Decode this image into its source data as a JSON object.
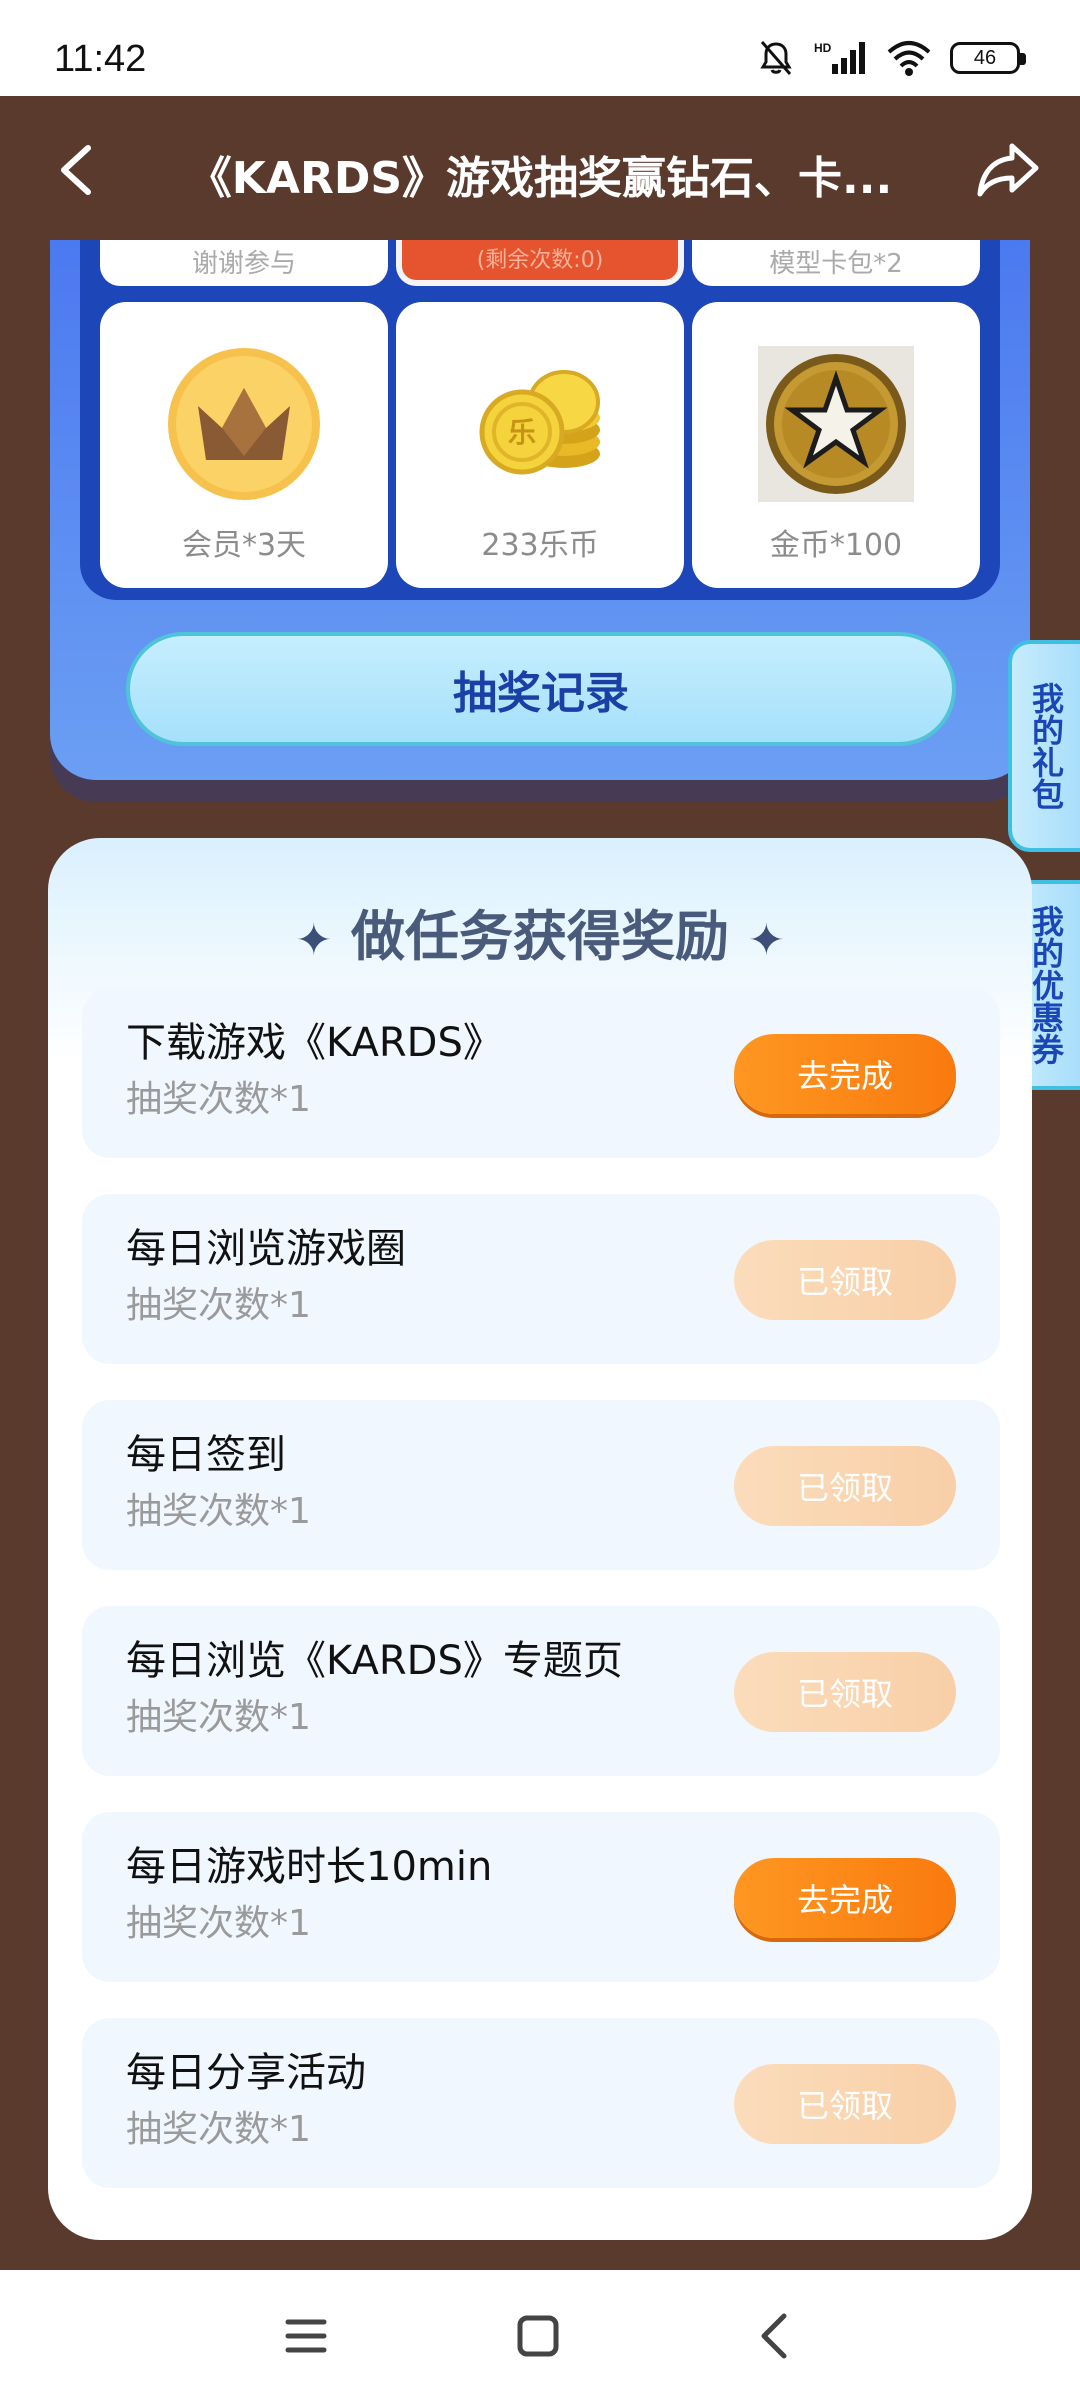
{
  "status_bar": {
    "time": "11:42",
    "battery": "46",
    "icons": [
      "bell-off-icon",
      "signal-icon",
      "wifi-icon",
      "battery-icon"
    ]
  },
  "header": {
    "title": "《KARDS》游戏抽奖赢钻石、卡...",
    "back_icon": "chevron-left-icon",
    "share_icon": "share-icon"
  },
  "prizes": {
    "partial_row": [
      {
        "label": "谢谢参与"
      },
      {
        "label": "(剩余次数:0)"
      },
      {
        "label": "模型卡包*2"
      }
    ],
    "items": [
      {
        "label": "会员*3天",
        "icon": "crown-icon"
      },
      {
        "label": "233乐币",
        "icon": "coins-icon"
      },
      {
        "label": "金币*100",
        "icon": "gold-coin-icon"
      }
    ],
    "record_button": "抽奖记录"
  },
  "side_tabs": {
    "gift": "我的礼包",
    "coupon": "我的优惠券"
  },
  "tasks": {
    "title": "做任务获得奖励",
    "items": [
      {
        "name": "下载游戏《KARDS》",
        "reward": "抽奖次数*1",
        "action": "去完成",
        "status": "pending"
      },
      {
        "name": "每日浏览游戏圈",
        "reward": "抽奖次数*1",
        "action": "已领取",
        "status": "claimed"
      },
      {
        "name": "每日签到",
        "reward": "抽奖次数*1",
        "action": "已领取",
        "status": "claimed"
      },
      {
        "name": "每日浏览《KARDS》专题页",
        "reward": "抽奖次数*1",
        "action": "已领取",
        "status": "claimed"
      },
      {
        "name": "每日游戏时长10min",
        "reward": "抽奖次数*1",
        "action": "去完成",
        "status": "pending"
      },
      {
        "name": "每日分享活动",
        "reward": "抽奖次数*1",
        "action": "已领取",
        "status": "claimed"
      }
    ]
  },
  "colors": {
    "background": "#5a3a2d",
    "accent_orange": "#f97a0e",
    "claimed_peach": "#f8cfa7",
    "panel_blue": "#1d47b9"
  },
  "nav_bar": {
    "icons": [
      "menu-icon",
      "home-icon",
      "back-icon"
    ]
  }
}
